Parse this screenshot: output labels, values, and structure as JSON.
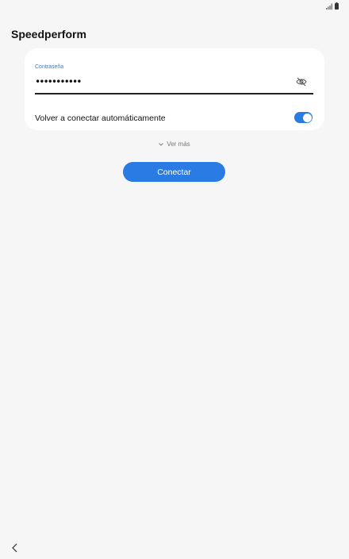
{
  "page": {
    "title": "Speedperform"
  },
  "password_field": {
    "label": "Contraseña",
    "value": "•••••••••••",
    "placeholder": "•••••••••••",
    "visibility_icon": "eye-slash-icon"
  },
  "auto_reconnect": {
    "label": "Volver a conectar automáticamente",
    "enabled": true
  },
  "see_more": {
    "label": "Ver más",
    "icon": "chevron-down-icon"
  },
  "connect_button": {
    "label": "Conectar"
  },
  "nav": {
    "back_icon": "chevron-left-icon"
  },
  "status_bar": {
    "icons": [
      "signal-icon",
      "battery-icon"
    ]
  },
  "colors": {
    "accent": "#2a7be4",
    "background": "#f6f6f6",
    "card": "#ffffff",
    "text": "#111111",
    "muted": "#777777"
  }
}
